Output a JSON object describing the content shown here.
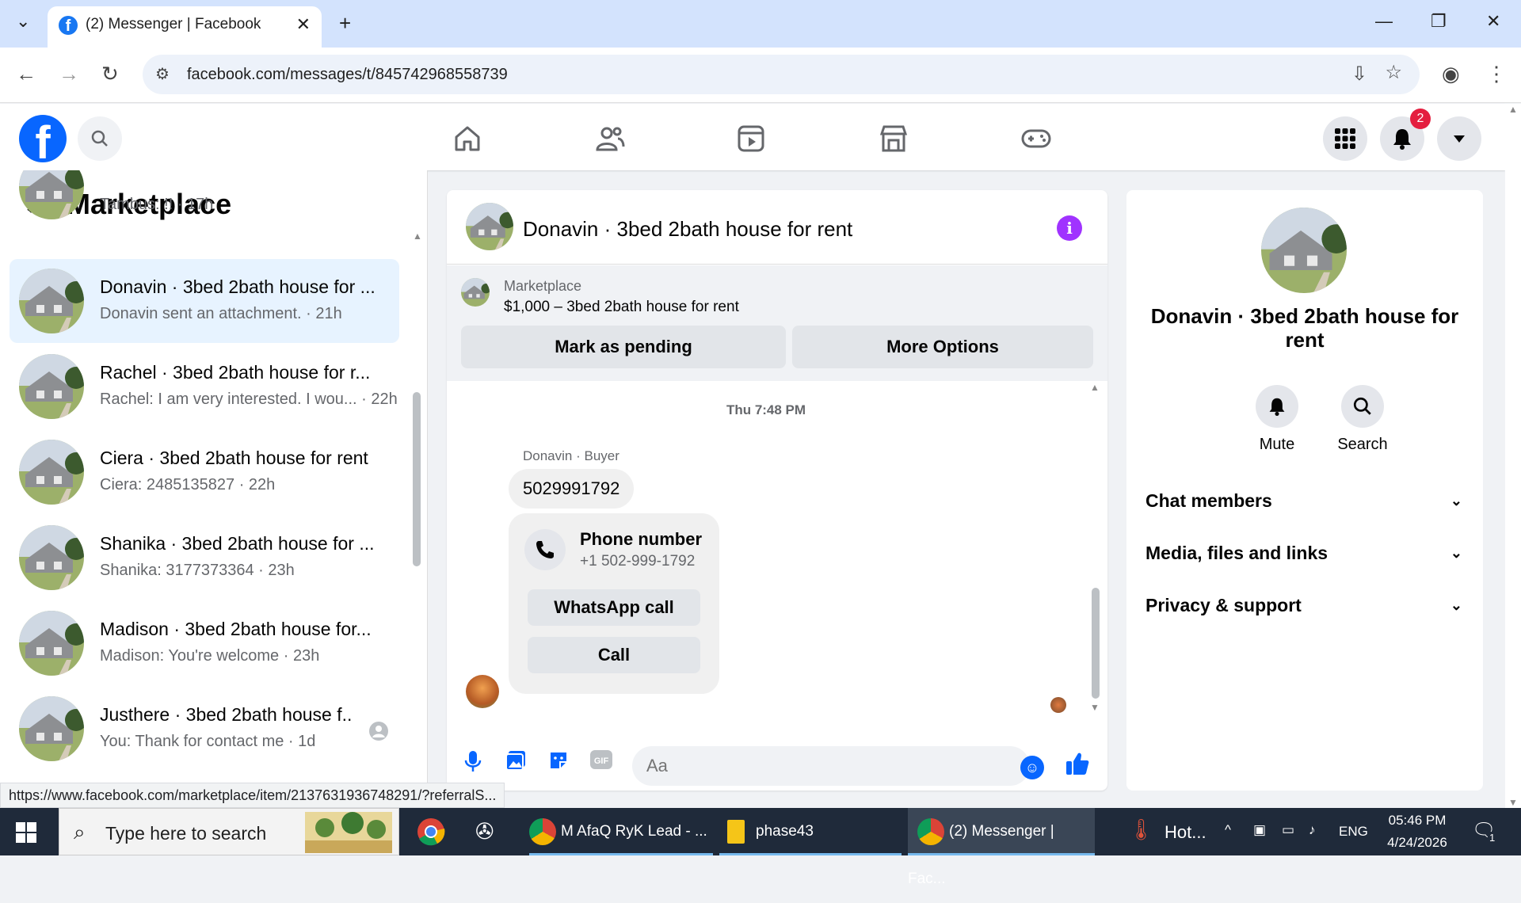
{
  "browser": {
    "tab_title": "(2) Messenger | Facebook",
    "url": "facebook.com/messages/t/845742968558739"
  },
  "header": {
    "notification_count": "2"
  },
  "sidebar": {
    "title": "Marketplace",
    "partial_preview": "Tambus: !! · 17h",
    "conversations": [
      {
        "name": "Donavin · 3bed 2bath house for ...",
        "preview": "Donavin sent an attachment. · 21h",
        "selected": true
      },
      {
        "name": "Rachel · 3bed 2bath house for r...",
        "preview": "Rachel: I am very interested. I wou... · 22h"
      },
      {
        "name": "Ciera · 3bed 2bath house for rent",
        "preview": "Ciera: 2485135827 · 22h"
      },
      {
        "name": "Shanika · 3bed 2bath house for ...",
        "preview": "Shanika: 3177373364 · 23h"
      },
      {
        "name": "Madison · 3bed 2bath house for...",
        "preview": "Madison: You're welcome · 23h"
      },
      {
        "name": "Justhere · 3bed 2bath house f...",
        "preview": "You: Thank for contact me · 1d"
      }
    ]
  },
  "chat": {
    "title": "Donavin · 3bed 2bath house for rent",
    "listing_label": "Marketplace",
    "listing_price": "$1,000 – 3bed 2bath house for rent",
    "mark_pending": "Mark as pending",
    "more_options": "More Options",
    "timestamp": "Thu 7:48 PM",
    "sender_label": "Donavin · Buyer",
    "message": "5029991792",
    "card_title": "Phone number",
    "card_number": "+1 502-999-1792",
    "whatsapp_call": "WhatsApp call",
    "call": "Call",
    "input_placeholder": "Aa"
  },
  "details": {
    "name": "Donavin · 3bed 2bath house for rent",
    "mute": "Mute",
    "search": "Search",
    "sections": [
      "Chat members",
      "Media, files and links",
      "Privacy & support"
    ]
  },
  "status_url": "https://www.facebook.com/marketplace/item/2137631936748291/?referralS...",
  "taskbar": {
    "search_placeholder": "Type here to search",
    "apps": [
      "M AfaQ RyK Lead - ...",
      "phase43",
      "(2) Messenger | Fac..."
    ],
    "weather": "Hot...",
    "lang": "ENG",
    "time": "05:46 PM",
    "date": "4/24/2026",
    "notif": "1"
  },
  "icons": [
    "facebook-icon",
    "search-icon",
    "home-icon",
    "friends-icon",
    "video-icon",
    "marketplace-icon",
    "gaming-icon",
    "menu-grid-icon",
    "bell-icon",
    "caret-down-icon",
    "back-arrow-icon",
    "info-icon",
    "microphone-icon",
    "photo-icon",
    "sticker-icon",
    "gif-icon",
    "emoji-icon",
    "like-icon",
    "phone-icon",
    "chevron-down-icon"
  ]
}
